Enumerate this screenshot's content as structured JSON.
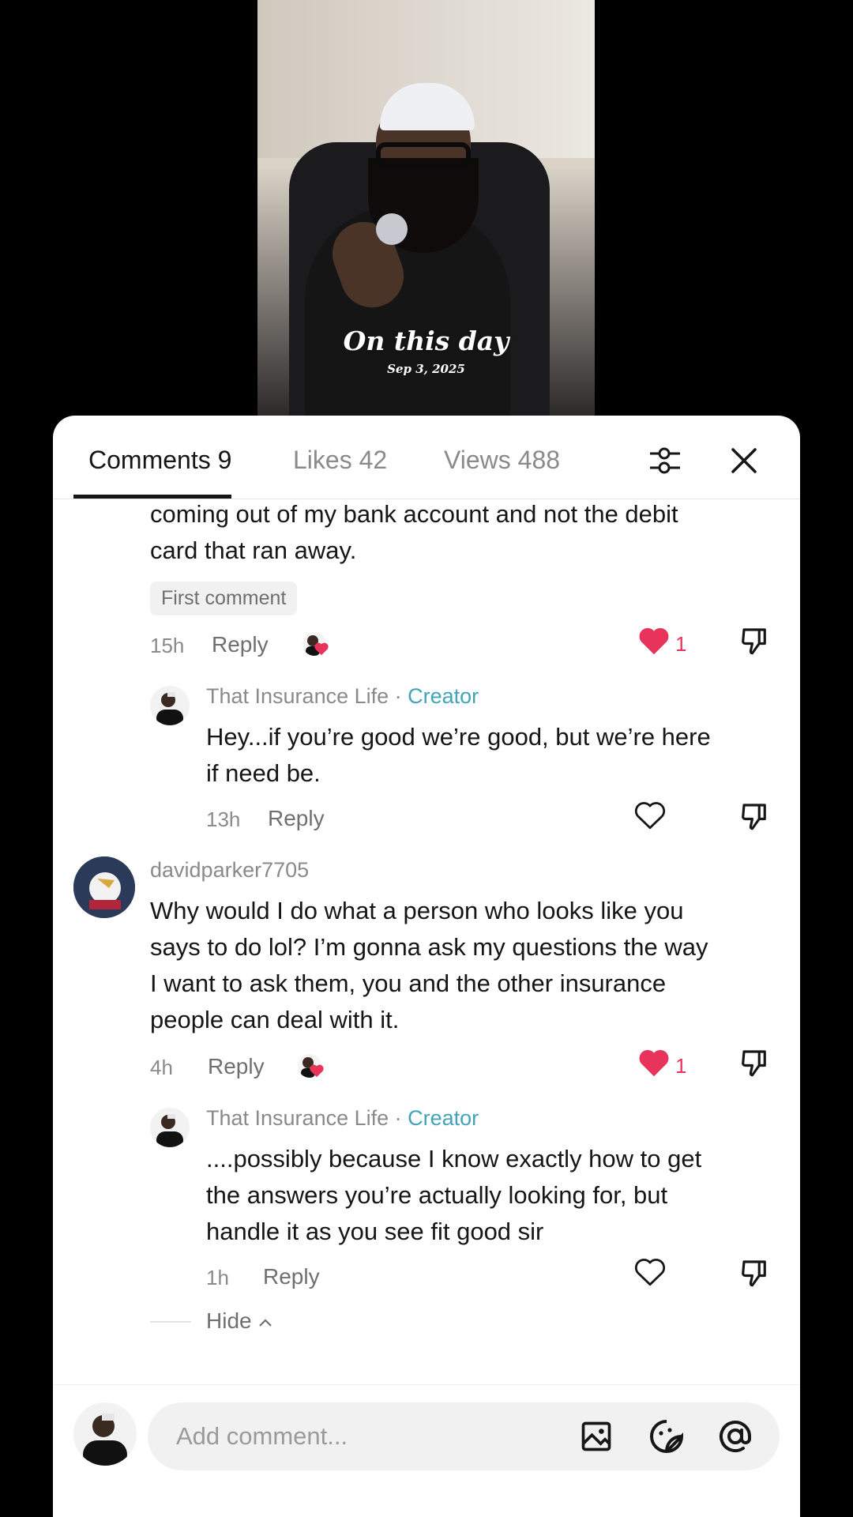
{
  "video": {
    "overlay_title": "On this day",
    "overlay_date": "Sep 3, 2025"
  },
  "tabs": [
    {
      "label": "Comments 9"
    },
    {
      "label": "Likes 42"
    },
    {
      "label": "Views 488"
    }
  ],
  "comments": {
    "c1": {
      "text_line1": "coming out of my bank account and not the debit",
      "text_line2": "card that ran away.",
      "badge": "First comment",
      "time": "15h",
      "reply": "Reply",
      "likes": "1"
    },
    "r1": {
      "username": "That Insurance Life",
      "creator": "Creator",
      "text_line1": "Hey...if you’re good we’re good, but we’re here",
      "text_line2": "if need be.",
      "time": "13h",
      "reply": "Reply"
    },
    "c2": {
      "username": "davidparker7705",
      "text_line1": "Why would I do what a person who looks like you",
      "text_line2": "says to do lol? I’m gonna ask my questions the way",
      "text_line3": "I want to ask them, you and the other insurance",
      "text_line4": "people can deal with it.",
      "time": "4h",
      "reply": "Reply",
      "likes": "1"
    },
    "r2": {
      "username": "That Insurance Life",
      "creator": "Creator",
      "text_line1": "....possibly because I know exactly how to get",
      "text_line2": "the answers you’re actually looking for, but",
      "text_line3": "handle it as you see fit good sir",
      "time": "1h",
      "reply": "Reply"
    },
    "hide_label": "Hide"
  },
  "input": {
    "placeholder": "Add comment..."
  },
  "colors": {
    "like_red": "#e8335a",
    "creator_teal": "#41a4ba"
  }
}
